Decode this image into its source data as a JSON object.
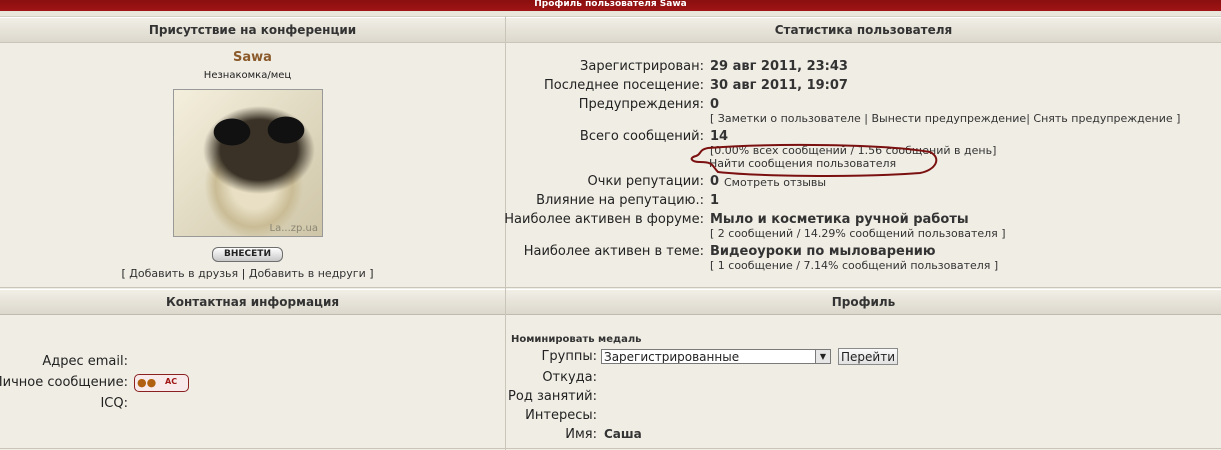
{
  "window": {
    "title": "Профиль пользователя Sawa"
  },
  "presence": {
    "header": "Присутствие на конференции",
    "username": "Sawa",
    "user_title": "Незнакомка/мец",
    "avatar_watermark": "La...zp.ua",
    "add_button": "ВНЕСЕТИ",
    "links_open": "[",
    "add_friend": "Добавить в друзья",
    "sep": "|",
    "add_enemy": "Добавить в недруги",
    "links_close": "]"
  },
  "stats": {
    "header": "Статистика пользователя",
    "registered_label": "Зарегистрирован:",
    "registered_value": "29 авг 2011, 23:43",
    "last_visit_label": "Последнее посещение:",
    "last_visit_value": "30 авг 2011, 19:07",
    "warnings_label": "Предупреждения:",
    "warnings_value": "0",
    "warn_links": {
      "open": "[",
      "notes": "Заметки о пользователе",
      "issue": "Вынести предупреждение",
      "remove": "Снять предупреждение",
      "close": "]"
    },
    "posts_label": "Всего сообщений:",
    "posts_value": "14",
    "posts_detail": "[0.00% всех сообщений / 1.56 сообщений в день]",
    "find_posts": "Найти сообщения пользователя",
    "rep_label": "Очки репутации:",
    "rep_value": "0",
    "rep_link": "Смотреть отзывы",
    "influence_label": "Влияние на репутацию.:",
    "influence_value": "1",
    "active_forum_label": "Наиболее активен в форуме:",
    "active_forum_value": "Мыло и косметика ручной работы",
    "active_forum_detail": "[ 2 сообщений / 14.29% сообщений пользователя ]",
    "active_topic_label": "Наиболее активен в теме:",
    "active_topic_value": "Видеоуроки по мыловарению",
    "active_topic_detail": "[ 1 сообщение / 7.14% сообщений пользователя ]"
  },
  "contact": {
    "header": "Контактная информация",
    "email_label": "Адрес email:",
    "pm_label": "Личное сообщение:",
    "pm_icon_text": "AC",
    "icq_label": "ICQ:"
  },
  "profile": {
    "header": "Профиль",
    "nominate": "Номинировать медаль",
    "groups_label": "Группы:",
    "groups_selected": "Зарегистрированные пользователи",
    "go_button": "Перейти",
    "from_label": "Откуда:",
    "occupation_label": "Род занятий:",
    "interests_label": "Интересы:",
    "name_label": "Имя:",
    "name_value": "Саша"
  },
  "colors": {
    "titlebar": "#a01414",
    "username": "#8b5a2b",
    "annotation_circle": "#7a1010"
  }
}
